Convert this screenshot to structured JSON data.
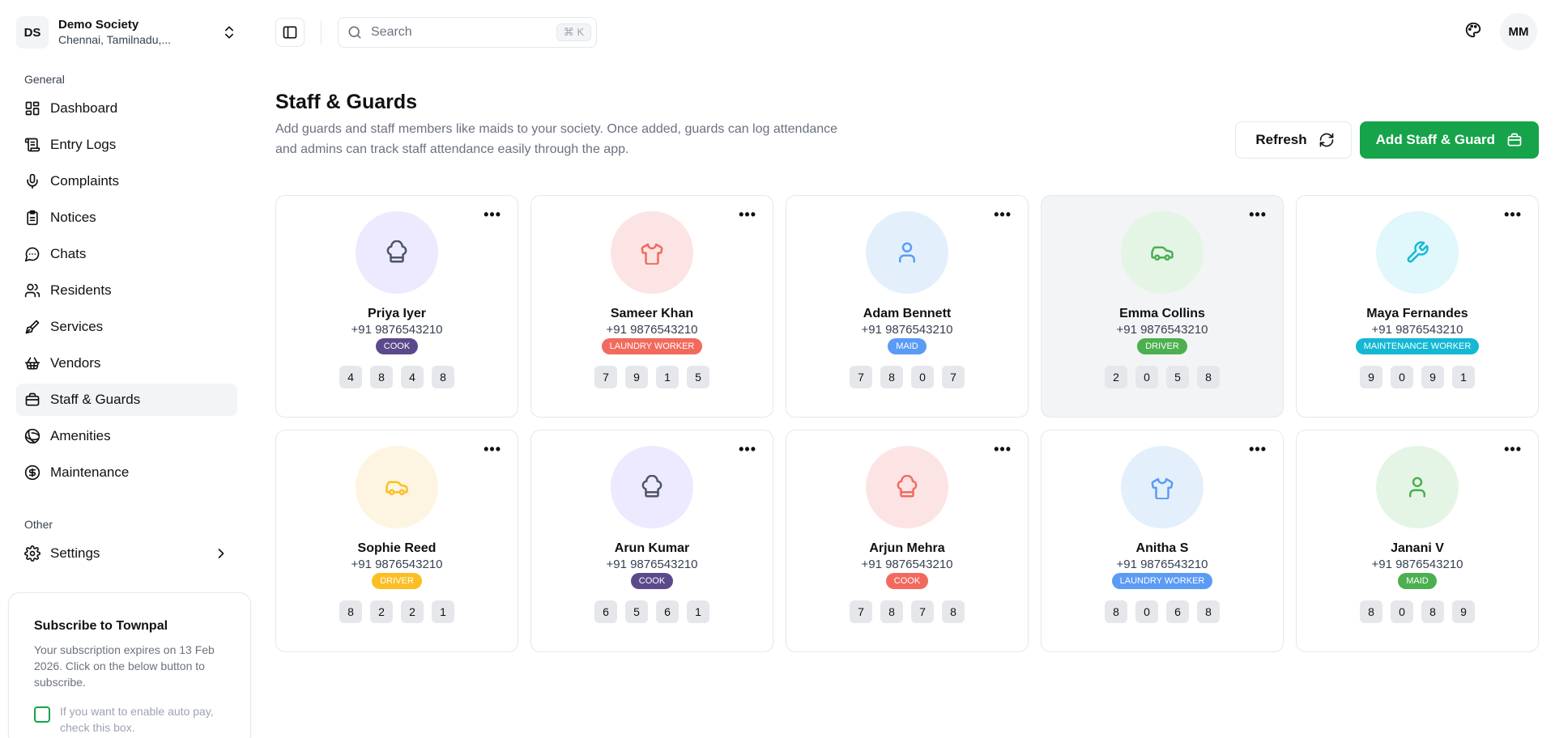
{
  "org": {
    "initials": "DS",
    "name": "Demo Society",
    "location": "Chennai, Tamilnadu,..."
  },
  "sidebar": {
    "general_label": "General",
    "items": [
      {
        "label": "Dashboard",
        "icon": "dashboard-icon"
      },
      {
        "label": "Entry Logs",
        "icon": "scroll-icon"
      },
      {
        "label": "Complaints",
        "icon": "mic-icon"
      },
      {
        "label": "Notices",
        "icon": "clipboard-icon"
      },
      {
        "label": "Chats",
        "icon": "chat-icon"
      },
      {
        "label": "Residents",
        "icon": "users-icon"
      },
      {
        "label": "Services",
        "icon": "brush-icon"
      },
      {
        "label": "Vendors",
        "icon": "basket-icon"
      },
      {
        "label": "Staff & Guards",
        "icon": "briefcase-icon"
      },
      {
        "label": "Amenities",
        "icon": "ball-icon"
      },
      {
        "label": "Maintenance",
        "icon": "dollar-icon"
      }
    ],
    "other_label": "Other",
    "settings_label": "Settings"
  },
  "subscribe": {
    "title": "Subscribe to Townpal",
    "description": "Your subscription expires on 13 Feb 2026. Click on the below button to subscribe.",
    "autopay_label": "If you want to enable auto pay, check this box."
  },
  "topbar": {
    "search_placeholder": "Search",
    "shortcut": "⌘ K",
    "user_initials": "MM"
  },
  "page": {
    "title": "Staff & Guards",
    "description": "Add guards and staff members like maids to your society. Once added, guards can log attendance and admins can track staff attendance easily through the app.",
    "refresh_label": "Refresh",
    "add_label": "Add Staff & Guard"
  },
  "colors": {
    "accent": "#16a34a"
  },
  "staff": [
    {
      "name": "Priya Iyer",
      "phone": "+91 9876543210",
      "role": "COOK",
      "role_color": "#5b4a8b",
      "icon": "chef-hat-icon",
      "icon_color": "#4b5563",
      "bg": "#ede9fe",
      "code": [
        "4",
        "8",
        "4",
        "8"
      ]
    },
    {
      "name": "Sameer Khan",
      "phone": "+91 9876543210",
      "role": "LAUNDRY WORKER",
      "role_color": "#f26a5e",
      "icon": "shirt-icon",
      "icon_color": "#f26a5e",
      "bg": "#fde4e4",
      "code": [
        "7",
        "9",
        "1",
        "5"
      ]
    },
    {
      "name": "Adam Bennett",
      "phone": "+91 9876543210",
      "role": "MAID",
      "role_color": "#5b9bf5",
      "icon": "user-icon",
      "icon_color": "#5b9bf5",
      "bg": "#e3f0fc",
      "code": [
        "7",
        "8",
        "0",
        "7"
      ]
    },
    {
      "name": "Emma Collins",
      "phone": "+91 9876543210",
      "role": "DRIVER",
      "role_color": "#4caf50",
      "icon": "car-icon",
      "icon_color": "#4caf50",
      "bg": "#e4f5e6",
      "code": [
        "2",
        "0",
        "5",
        "8"
      ]
    },
    {
      "name": "Maya Fernandes",
      "phone": "+91 9876543210",
      "role": "MAINTENANCE WORKER",
      "role_color": "#14b8d4",
      "icon": "wrench-icon",
      "icon_color": "#14b8d4",
      "bg": "#e0f7fb",
      "code": [
        "9",
        "0",
        "9",
        "1"
      ]
    },
    {
      "name": "Sophie Reed",
      "phone": "+91 9876543210",
      "role": "DRIVER",
      "role_color": "#fbbf24",
      "icon": "car-icon",
      "icon_color": "#fbbf24",
      "bg": "#fdf5e1",
      "code": [
        "8",
        "2",
        "2",
        "1"
      ]
    },
    {
      "name": "Arun Kumar",
      "phone": "+91 9876543210",
      "role": "COOK",
      "role_color": "#5b4a8b",
      "icon": "chef-hat-icon",
      "icon_color": "#4b5563",
      "bg": "#ede9fe",
      "code": [
        "6",
        "5",
        "6",
        "1"
      ]
    },
    {
      "name": "Arjun Mehra",
      "phone": "+91 9876543210",
      "role": "COOK",
      "role_color": "#f26a5e",
      "icon": "chef-hat-icon",
      "icon_color": "#f26a5e",
      "bg": "#fde4e4",
      "code": [
        "7",
        "8",
        "7",
        "8"
      ]
    },
    {
      "name": "Anitha S",
      "phone": "+91 9876543210",
      "role": "LAUNDRY WORKER",
      "role_color": "#5b9bf5",
      "icon": "shirt-icon",
      "icon_color": "#5b9bf5",
      "bg": "#e3f0fc",
      "code": [
        "8",
        "0",
        "6",
        "8"
      ]
    },
    {
      "name": "Janani V",
      "phone": "+91 9876543210",
      "role": "MAID",
      "role_color": "#4caf50",
      "icon": "user-icon",
      "icon_color": "#4caf50",
      "bg": "#e4f5e6",
      "code": [
        "8",
        "0",
        "8",
        "9"
      ]
    }
  ]
}
